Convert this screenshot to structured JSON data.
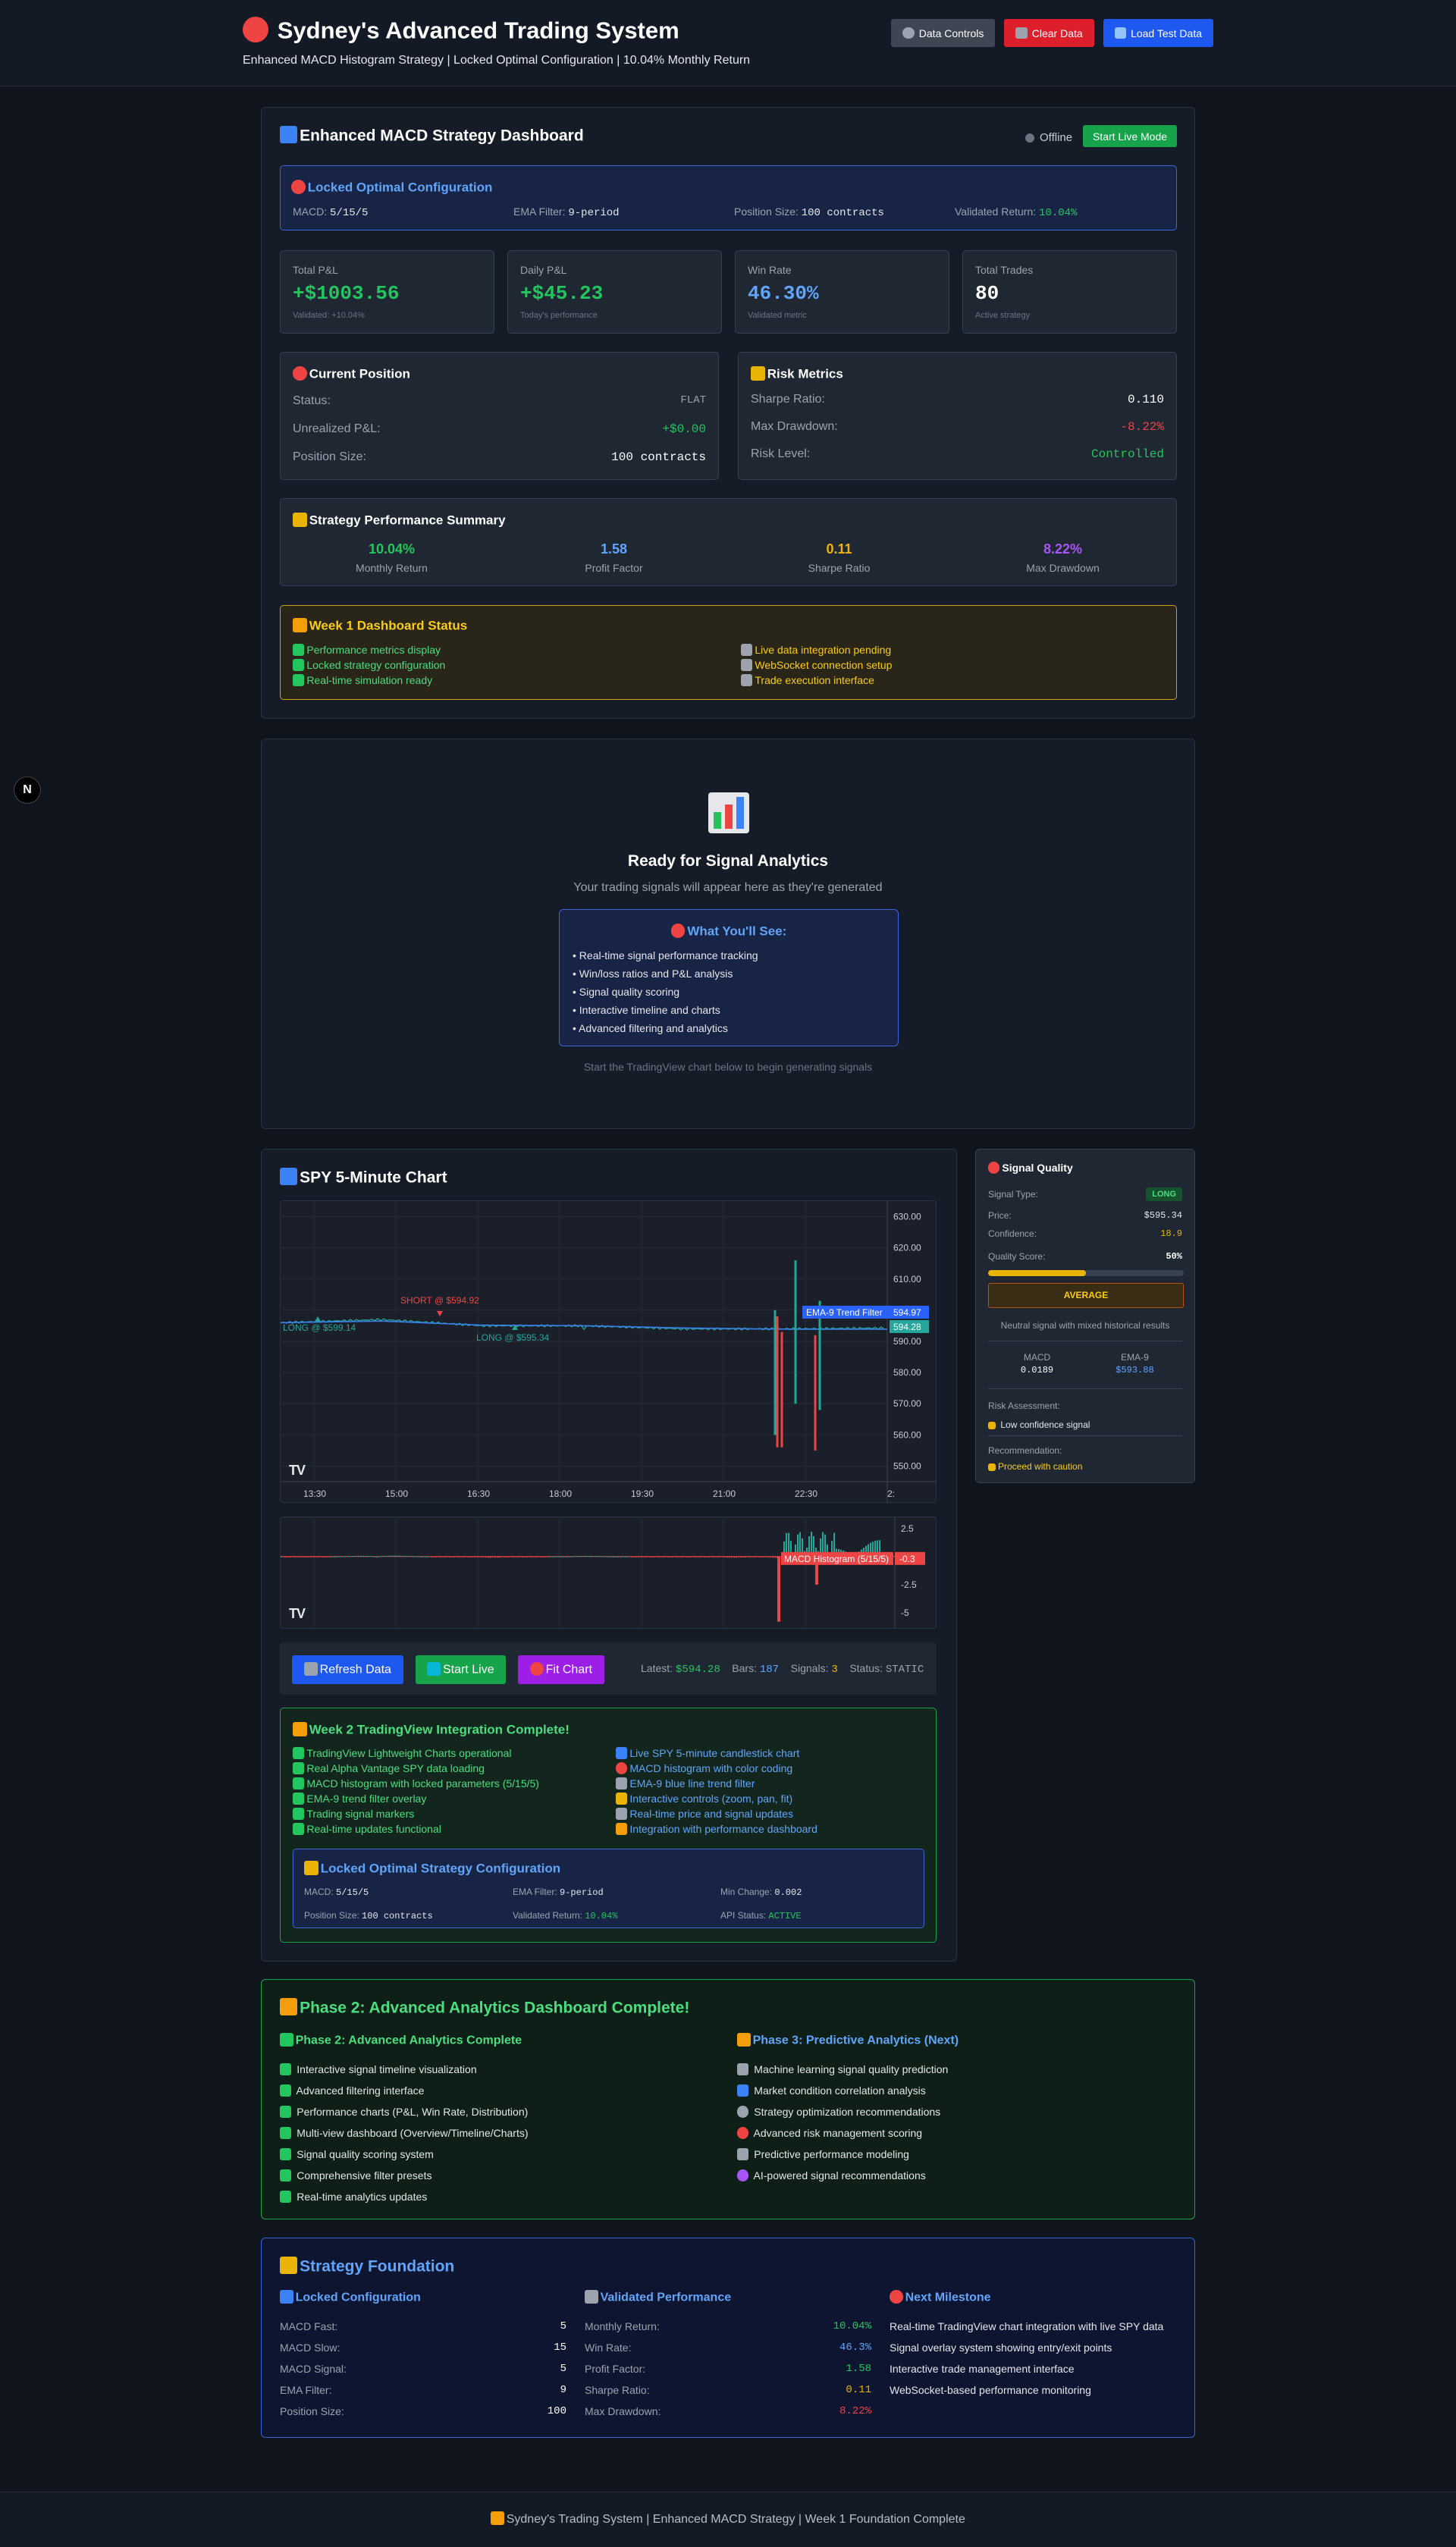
{
  "header": {
    "title": "Sydney's Advanced Trading System",
    "subtitle": "Enhanced MACD Histogram Strategy | Locked Optimal Configuration | 10.04% Monthly Return",
    "buttons": [
      "Data Controls",
      "Clear Data",
      "Load Test Data"
    ]
  },
  "dashboard": {
    "title": "Enhanced MACD Strategy Dashboard",
    "status": "Offline",
    "live_button": "Start Live Mode",
    "locked": {
      "title": "Locked Optimal Configuration",
      "items": [
        {
          "label": "MACD:",
          "value": "5/15/5"
        },
        {
          "label": "EMA Filter:",
          "value": "9-period"
        },
        {
          "label": "Position Size:",
          "value": "100 contracts"
        },
        {
          "label": "Validated Return:",
          "value": "10.04%"
        }
      ]
    },
    "metrics": [
      {
        "label": "Total P&L",
        "value": "+$1003.56",
        "note": "Validated: +10.04%"
      },
      {
        "label": "Daily P&L",
        "value": "+$45.23",
        "note": "Today's performance"
      },
      {
        "label": "Win Rate",
        "value": "46.30%",
        "note": "Validated metric"
      },
      {
        "label": "Total Trades",
        "value": "80",
        "note": "Active strategy"
      }
    ],
    "position": {
      "title": "Current Position",
      "rows": [
        {
          "label": "Status:",
          "value": "FLAT"
        },
        {
          "label": "Unrealized P&L:",
          "value": "+$0.00"
        },
        {
          "label": "Position Size:",
          "value": "100 contracts"
        }
      ]
    },
    "risk": {
      "title": "Risk Metrics",
      "rows": [
        {
          "label": "Sharpe Ratio:",
          "value": "0.110"
        },
        {
          "label": "Max Drawdown:",
          "value": "-8.22%"
        },
        {
          "label": "Risk Level:",
          "value": "Controlled"
        }
      ]
    },
    "summary": {
      "title": "Strategy Performance Summary",
      "items": [
        {
          "value": "10.04%",
          "label": "Monthly Return"
        },
        {
          "value": "1.58",
          "label": "Profit Factor"
        },
        {
          "value": "0.11",
          "label": "Sharpe Ratio"
        },
        {
          "value": "8.22%",
          "label": "Max Drawdown"
        }
      ]
    },
    "week1": {
      "title": "Week 1 Dashboard Status",
      "done": [
        "Performance metrics display",
        "Locked strategy configuration",
        "Real-time simulation ready"
      ],
      "pending": [
        "Live data integration pending",
        "WebSocket connection setup",
        "Trade execution interface"
      ]
    }
  },
  "float_button": "N",
  "analytics": {
    "title": "Ready for Signal Analytics",
    "subtitle": "Your trading signals will appear here as they're generated",
    "box_title": "What You'll See:",
    "items": [
      "• Real-time signal performance tracking",
      "• Win/loss ratios and P&L analysis",
      "• Signal quality scoring",
      "• Interactive timeline and charts",
      "• Advanced filtering and analytics"
    ],
    "footer": "Start the TradingView chart below to begin generating signals"
  },
  "chart": {
    "title": "SPY 5-Minute Chart",
    "price_axis": [
      "630.00",
      "620.00",
      "610.00",
      "600.00",
      "590.00",
      "580.00",
      "570.00",
      "560.00",
      "550.00"
    ],
    "time_axis": [
      "13:30",
      "15:00",
      "16:30",
      "18:00",
      "19:30",
      "21:00",
      "22:30",
      "2:"
    ],
    "labels": {
      "short": "SHORT @ $594.92",
      "long1": "LONG @ $599.14",
      "long2": "LONG @ $595.34",
      "ema": "EMA-9 Trend Filter",
      "price1": "594.97",
      "price2": "594.28",
      "macd": "MACD Histogram (5/15/5)",
      "macd_val": "-0.3"
    },
    "macd_axis": [
      "2.5",
      "0",
      "-2.5",
      "-5"
    ],
    "controls": {
      "refresh": "Refresh Data",
      "start": "Start Live",
      "fit": "Fit Chart",
      "latest_label": "Latest:",
      "latest": "$594.28",
      "bars_label": "Bars:",
      "bars": "187",
      "signals_label": "Signals:",
      "signals": "3",
      "status_label": "Status:",
      "status": "STATIC"
    },
    "week2": {
      "title": "Week 2 TradingView Integration Complete!",
      "left": [
        "TradingView Lightweight Charts operational",
        "Real Alpha Vantage SPY data loading",
        "MACD histogram with locked parameters (5/15/5)",
        "EMA-9 trend filter overlay",
        "Trading signal markers",
        "Real-time updates functional"
      ],
      "right": [
        "Live SPY 5-minute candlestick chart",
        "MACD histogram with color coding",
        "EMA-9 blue line trend filter",
        "Interactive controls (zoom, pan, fit)",
        "Real-time price and signal updates",
        "Integration with performance dashboard"
      ]
    },
    "locked2": {
      "title": "Locked Optimal Strategy Configuration",
      "items": [
        {
          "label": "MACD:",
          "value": "5/15/5"
        },
        {
          "label": "EMA Filter:",
          "value": "9-period"
        },
        {
          "label": "Min Change:",
          "value": "0.002"
        },
        {
          "label": "Position Size:",
          "value": "100 contracts"
        },
        {
          "label": "Validated Return:",
          "value": "10.04%"
        },
        {
          "label": "API Status:",
          "value": "ACTIVE"
        }
      ]
    }
  },
  "chart_data": [
    {
      "type": "line",
      "title": "SPY 5-Minute Chart",
      "ylim": [
        545,
        635
      ],
      "x": [
        "13:30",
        "15:00",
        "16:30",
        "18:00",
        "19:30",
        "21:00",
        "22:30"
      ],
      "series": [
        {
          "values": [
            596,
            597,
            595,
            595,
            594,
            594,
            594.28
          ]
        },
        {
          "name": "EMA-9 Trend Filter",
          "values": [
            596,
            596.5,
            595.2,
            595,
            594.3,
            593.9,
            593.88
          ]
        }
      ]
    },
    {
      "type": "bar",
      "title": "MACD Histogram (5/15/5)",
      "ylim": [
        -6,
        3
      ],
      "x": [
        "13:30",
        "15:00",
        "16:30",
        "18:00",
        "19:30",
        "21:00",
        "22:30"
      ],
      "values": [
        -0.2,
        0.2,
        -0.2,
        0.1,
        -0.1,
        -0.2,
        2.5
      ],
      "last": -0.3
    }
  ],
  "quality": {
    "title": "Signal Quality",
    "rows": [
      {
        "label": "Signal Type:",
        "value": "LONG"
      },
      {
        "label": "Price:",
        "value": "$595.34"
      },
      {
        "label": "Confidence:",
        "value": "18.9"
      }
    ],
    "score_label": "Quality Score:",
    "score": "50%",
    "score_fraction": 0.5,
    "badge": "AVERAGE",
    "note": "Neutral signal with mixed historical results",
    "macd_label": "MACD",
    "macd": "0.0189",
    "ema_label": "EMA-9",
    "ema": "$593.88",
    "risk_label": "Risk Assessment:",
    "risk": "Low confidence signal",
    "rec_label": "Recommendation:",
    "rec": "Proceed with caution"
  },
  "phase": {
    "title": "Phase 2: Advanced Analytics Dashboard Complete!",
    "left_title": "Phase 2: Advanced Analytics Complete",
    "left": [
      "Interactive signal timeline visualization",
      "Advanced filtering interface",
      "Performance charts (P&L, Win Rate, Distribution)",
      "Multi-view dashboard (Overview/Timeline/Charts)",
      "Signal quality scoring system",
      "Comprehensive filter presets",
      "Real-time analytics updates"
    ],
    "right_title": "Phase 3: Predictive Analytics (Next)",
    "right": [
      "Machine learning signal quality prediction",
      "Market condition correlation analysis",
      "Strategy optimization recommendations",
      "Advanced risk management scoring",
      "Predictive performance modeling",
      "AI-powered signal recommendations"
    ]
  },
  "foundation": {
    "title": "Strategy Foundation",
    "c1_title": "Locked Configuration",
    "c1": [
      {
        "label": "MACD Fast:",
        "value": "5"
      },
      {
        "label": "MACD Slow:",
        "value": "15"
      },
      {
        "label": "MACD Signal:",
        "value": "5"
      },
      {
        "label": "EMA Filter:",
        "value": "9"
      },
      {
        "label": "Position Size:",
        "value": "100"
      }
    ],
    "c2_title": "Validated Performance",
    "c2": [
      {
        "label": "Monthly Return:",
        "value": "10.04%"
      },
      {
        "label": "Win Rate:",
        "value": "46.3%"
      },
      {
        "label": "Profit Factor:",
        "value": "1.58"
      },
      {
        "label": "Sharpe Ratio:",
        "value": "0.11"
      },
      {
        "label": "Max Drawdown:",
        "value": "8.22%"
      }
    ],
    "c3_title": "Next Milestone",
    "c3": [
      "Real-time TradingView chart integration with live SPY data",
      "Signal overlay system showing entry/exit points",
      "Interactive trade management interface",
      "WebSocket-based performance monitoring"
    ]
  },
  "footer": "Sydney's Trading System | Enhanced MACD Strategy | Week 1 Foundation Complete"
}
